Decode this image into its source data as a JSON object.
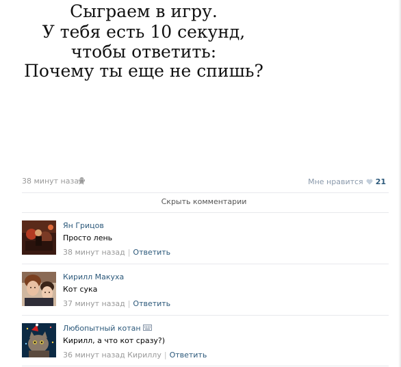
{
  "post": {
    "image_text": [
      "Сыграем в игру.",
      "У тебя есть 10 секунд,",
      "чтобы ответить:",
      "Почему ты еще не спишь?"
    ],
    "time": "38 минут назад",
    "platform_icon": "android-icon",
    "like_label": "Мне нравится",
    "like_icon": "heart-icon",
    "like_count": "21"
  },
  "hide_comments_label": "Скрыть комментарии",
  "comments": [
    {
      "author": "Ян Грицов",
      "text": "Просто лень",
      "time": "38 минут назад",
      "reply_label": "Ответить"
    },
    {
      "author": "Кирилл Макуха",
      "text": "Кот сука",
      "time": "37 минут назад",
      "reply_label": "Ответить"
    },
    {
      "author": "Любопытный котан",
      "author_icon": "keyboard-icon",
      "text": "Кирилл, а что кот сразу?)",
      "time": "36 минут назад Кириллу",
      "reply_label": "Ответить"
    }
  ],
  "colors": {
    "link": "#2b587a",
    "meta": "#999999",
    "divider": "#e7e8ec"
  }
}
